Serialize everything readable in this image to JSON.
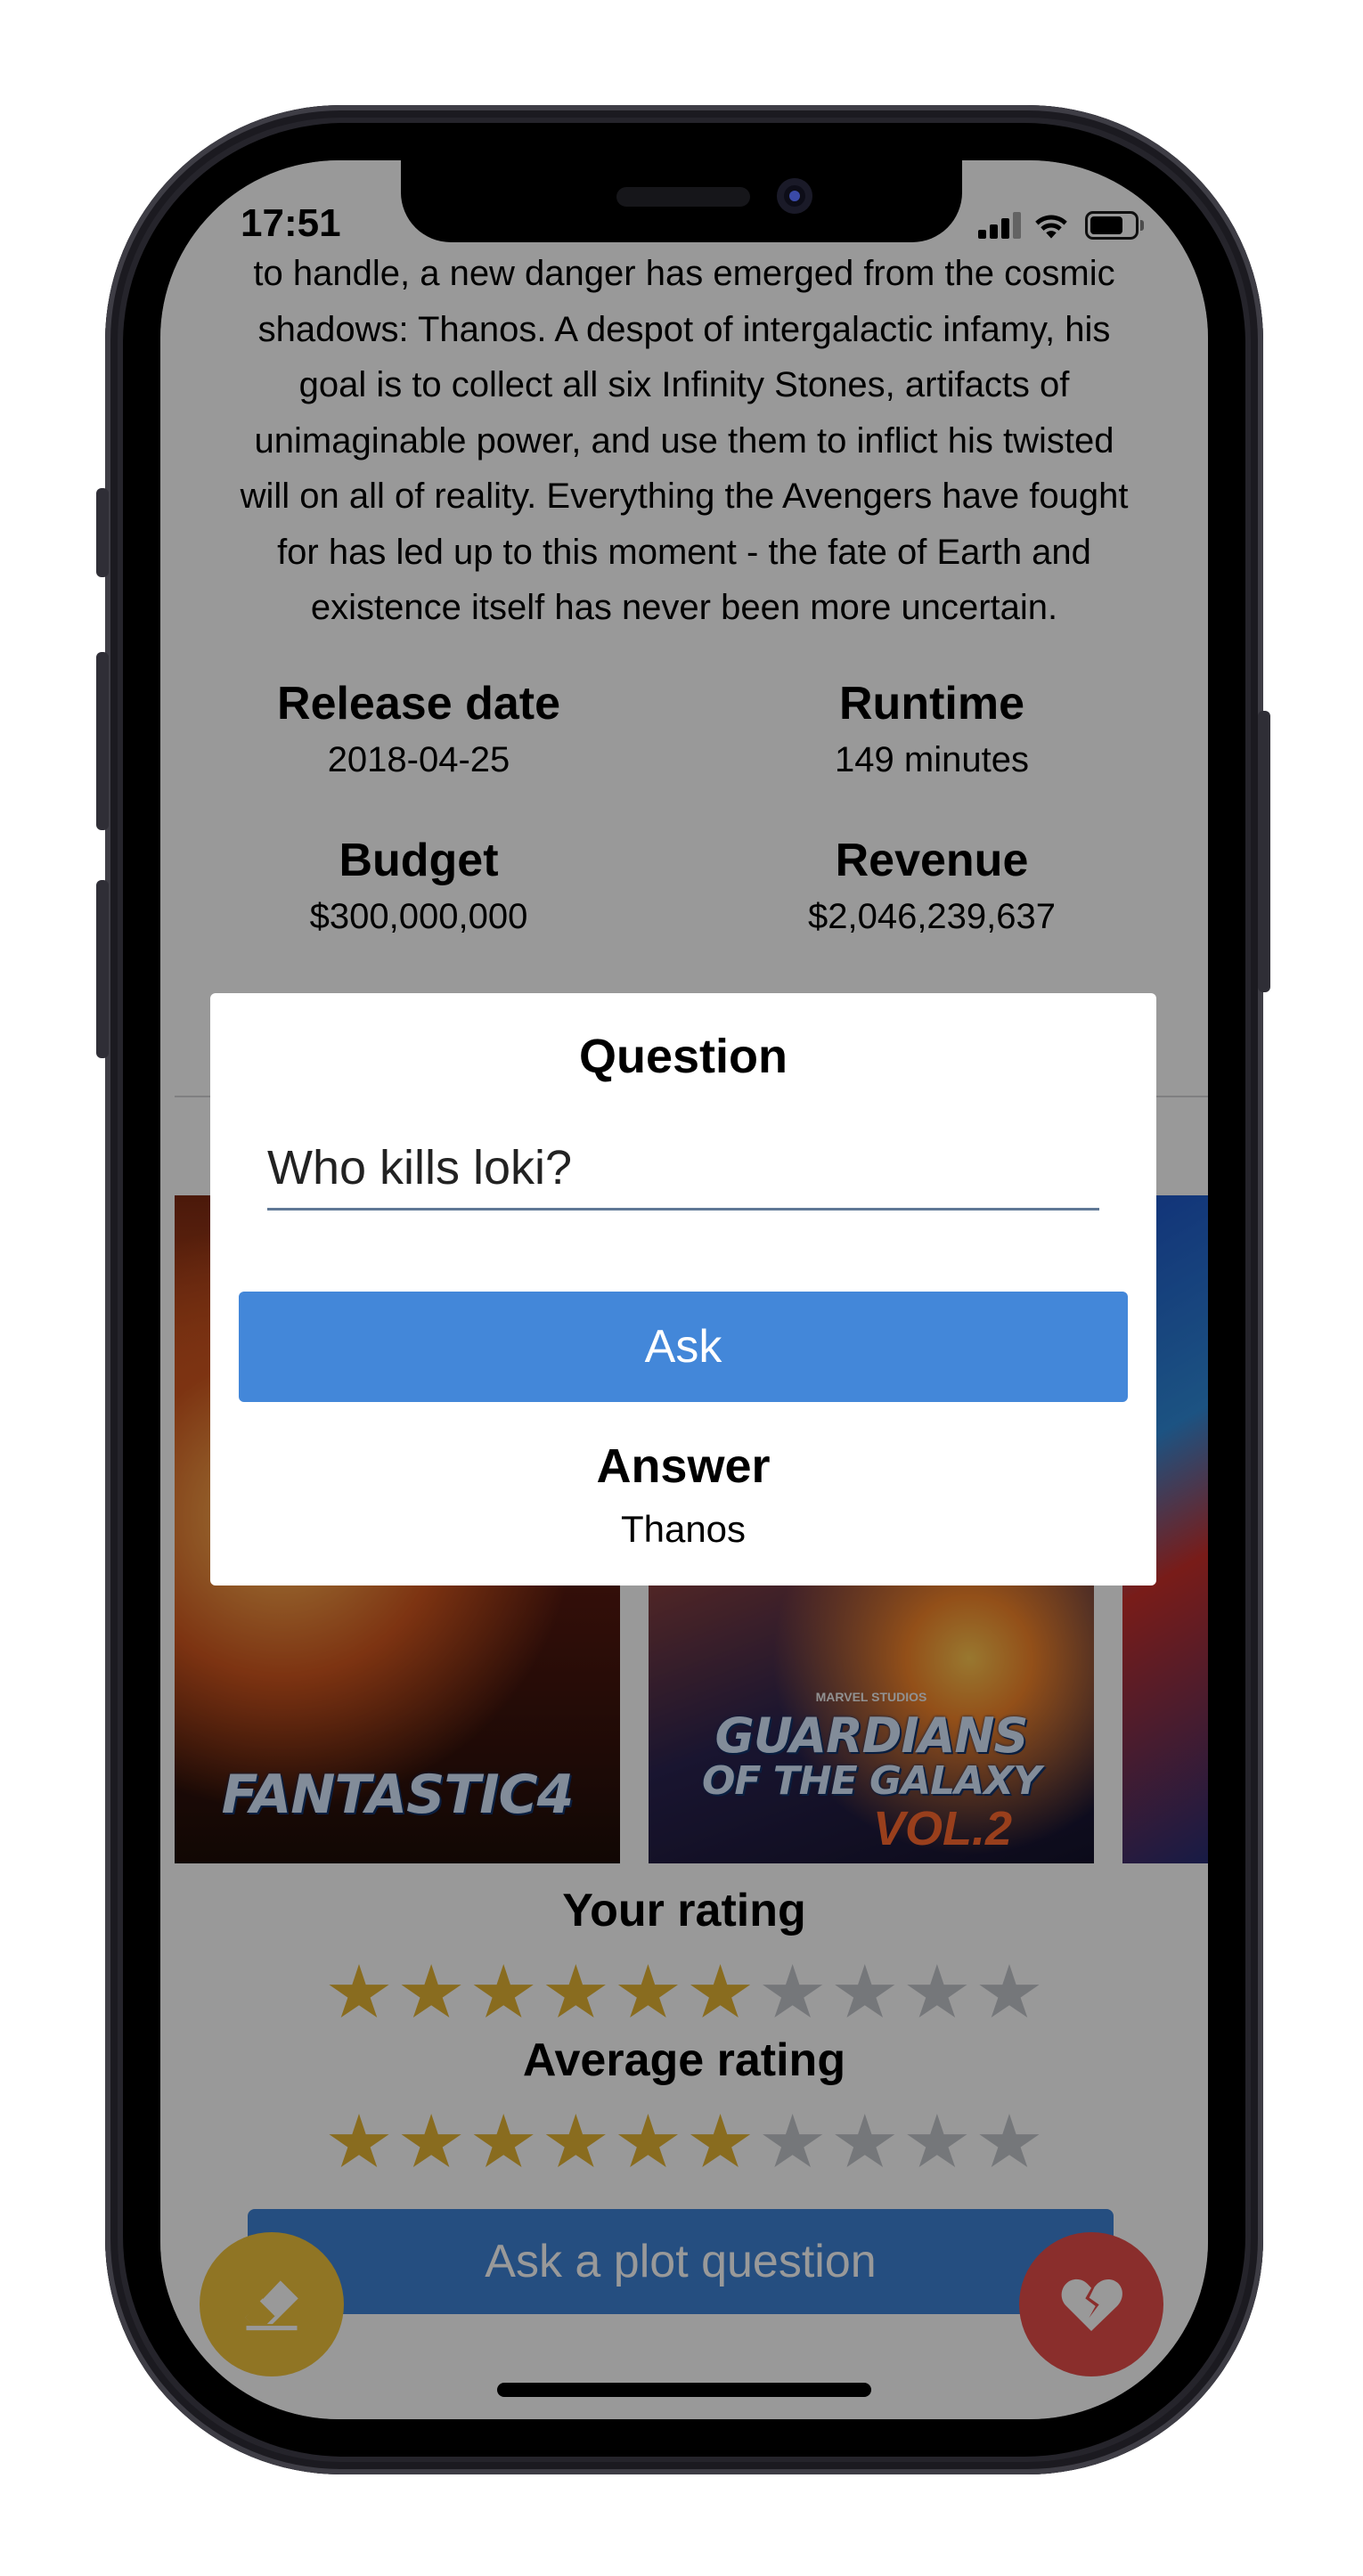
{
  "status_bar": {
    "time": "17:51"
  },
  "movie": {
    "overview_lines": [
      "to handle, a new danger has emerged from the cosmic",
      "shadows: Thanos. A despot of intergalactic infamy, his",
      "goal is to collect all six Infinity Stones, artifacts of",
      "unimaginable power, and use them to inflict his twisted",
      "will on all of reality. Everything the Avengers have fought",
      "for has led up to this moment - the fate of Earth and",
      "existence itself has never been more uncertain."
    ],
    "facts": {
      "release_label": "Release date",
      "release_value": "2018-04-25",
      "runtime_label": "Runtime",
      "runtime_value": "149 minutes",
      "budget_label": "Budget",
      "budget_value": "$300,000,000",
      "revenue_label": "Revenue",
      "revenue_value": "$2,046,239,637"
    }
  },
  "similar_movies": {
    "posters": [
      {
        "title": "FANTASTIC4"
      },
      {
        "brand": "MARVEL STUDIOS",
        "title_top": "GUARDIANS",
        "title_mid": "OF THE GALAXY",
        "title_sub": "VOL.2"
      }
    ]
  },
  "ratings": {
    "your_title": "Your rating",
    "your_value": 6,
    "average_title": "Average rating",
    "average_value": 6,
    "max": 10
  },
  "actions": {
    "plot_question_label": "Ask a plot question",
    "eraser_icon": "eraser-icon",
    "broken_heart_icon": "broken-heart-icon"
  },
  "modal": {
    "title": "Question",
    "question_value": "Who kills loki?",
    "ask_label": "Ask",
    "answer_title": "Answer",
    "answer_value": "Thanos"
  },
  "colors": {
    "star_filled": "#e4b434",
    "star_empty": "#c4c6cc",
    "ask_button": "#4387d9",
    "plot_button": "#3e83d6",
    "eraser_fab": "#f0c33c",
    "heart_fab": "#e64d4a"
  }
}
